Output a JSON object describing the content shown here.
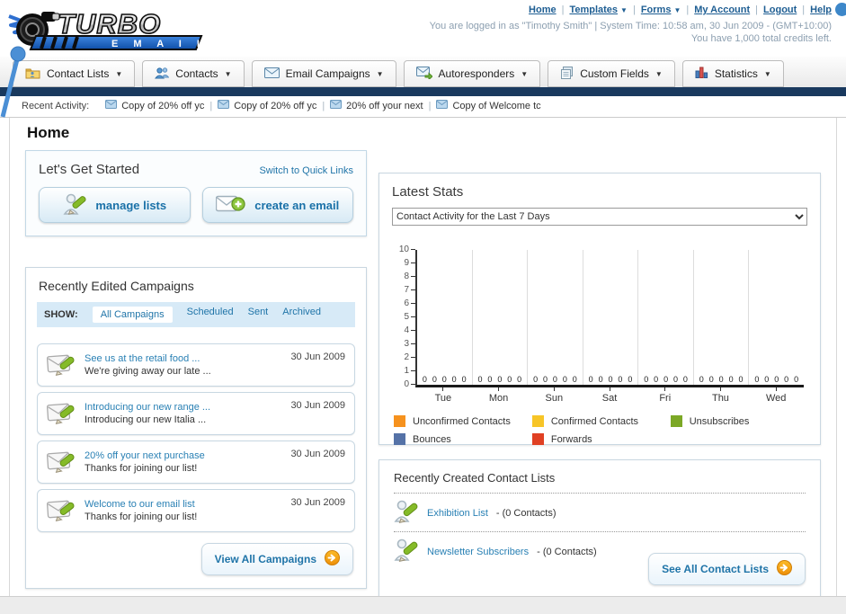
{
  "header": {
    "logo_title": "TURBO",
    "logo_subtitle": "EMAIL",
    "top_links": [
      {
        "label": "Home",
        "dropdown": false
      },
      {
        "label": "Templates",
        "dropdown": true
      },
      {
        "label": "Forms",
        "dropdown": true
      },
      {
        "label": "My Account",
        "dropdown": false
      },
      {
        "label": "Logout",
        "dropdown": false
      },
      {
        "label": "Help",
        "dropdown": false
      }
    ],
    "login_line": "You are logged in as \"Timothy Smith\" | System Time: 10:58 am, 30 Jun 2009 - (GMT+10:00)",
    "credits_line": "You have 1,000 total credits left."
  },
  "nav": {
    "tabs": [
      {
        "label": "Contact Lists",
        "icon": "contact-lists-icon"
      },
      {
        "label": "Contacts",
        "icon": "contacts-icon"
      },
      {
        "label": "Email Campaigns",
        "icon": "email-campaigns-icon"
      },
      {
        "label": "Autoresponders",
        "icon": "autoresponders-icon"
      },
      {
        "label": "Custom Fields",
        "icon": "custom-fields-icon"
      },
      {
        "label": "Statistics",
        "icon": "statistics-icon"
      }
    ]
  },
  "recent_activity": {
    "label": "Recent Activity:",
    "items": [
      "Copy of 20% off yc",
      "Copy of 20% off yc",
      "20% off your next",
      "Copy of Welcome tc"
    ]
  },
  "home": {
    "title": "Home"
  },
  "get_started": {
    "title": "Let's Get Started",
    "switch_link": "Switch to Quick Links",
    "buttons": [
      {
        "label": "manage lists",
        "icon": "manage-lists-icon"
      },
      {
        "label": "create an email",
        "icon": "create-email-icon"
      }
    ]
  },
  "campaigns": {
    "title": "Recently Edited Campaigns",
    "show_label": "SHOW:",
    "filters": [
      {
        "label": "All Campaigns",
        "selected": true
      },
      {
        "label": "Scheduled",
        "selected": false
      },
      {
        "label": "Sent",
        "selected": false
      },
      {
        "label": "Archived",
        "selected": false
      }
    ],
    "items": [
      {
        "title": "See us at the retail food ...",
        "subtitle": "We're giving away our late ...",
        "date": "30 Jun 2009"
      },
      {
        "title": "Introducing our new range ...",
        "subtitle": "Introducing our new Italia ...",
        "date": "30 Jun 2009"
      },
      {
        "title": "20% off your next purchase",
        "subtitle": "Thanks for joining our list!",
        "date": "30 Jun 2009"
      },
      {
        "title": "Welcome to our email list",
        "subtitle": "Thanks for joining our list!",
        "date": "30 Jun 2009"
      }
    ],
    "view_all_label": "View All Campaigns"
  },
  "latest_stats": {
    "title": "Latest Stats",
    "selector_value": "Contact Activity for the Last 7 Days"
  },
  "chart_data": {
    "type": "bar",
    "title": "Contact Activity for the Last 7 Days",
    "categories": [
      "Tue",
      "Mon",
      "Sun",
      "Sat",
      "Fri",
      "Thu",
      "Wed"
    ],
    "series": [
      {
        "name": "Unconfirmed Contacts",
        "color": "#F6921E",
        "values": [
          0,
          0,
          0,
          0,
          0,
          0,
          0
        ]
      },
      {
        "name": "Confirmed Contacts",
        "color": "#F7C527",
        "values": [
          0,
          0,
          0,
          0,
          0,
          0,
          0
        ]
      },
      {
        "name": "Unsubscribes",
        "color": "#7CA826",
        "values": [
          0,
          0,
          0,
          0,
          0,
          0,
          0
        ]
      },
      {
        "name": "Bounces",
        "color": "#5572A7",
        "values": [
          0,
          0,
          0,
          0,
          0,
          0,
          0
        ]
      },
      {
        "name": "Forwards",
        "color": "#E04023",
        "values": [
          0,
          0,
          0,
          0,
          0,
          0,
          0
        ]
      }
    ],
    "ylim": [
      0,
      10
    ],
    "ytick_step": 1,
    "grid": "vertical-group-separators",
    "legend_position": "bottom",
    "value_labels": "0 shown for every series in every group"
  },
  "contact_lists": {
    "title": "Recently Created Contact Lists",
    "items": [
      {
        "name": "Exhibition List",
        "count": "- (0 Contacts)"
      },
      {
        "name": "Newsletter Subscribers",
        "count": "- (0 Contacts)"
      }
    ],
    "see_all_label": "See All Contact Lists"
  },
  "colors": {
    "navy_bar": "#19395E",
    "link_blue": "#1F74A8",
    "filter_strip": "#D7EAF7",
    "accent_orange": "#F39C12"
  }
}
